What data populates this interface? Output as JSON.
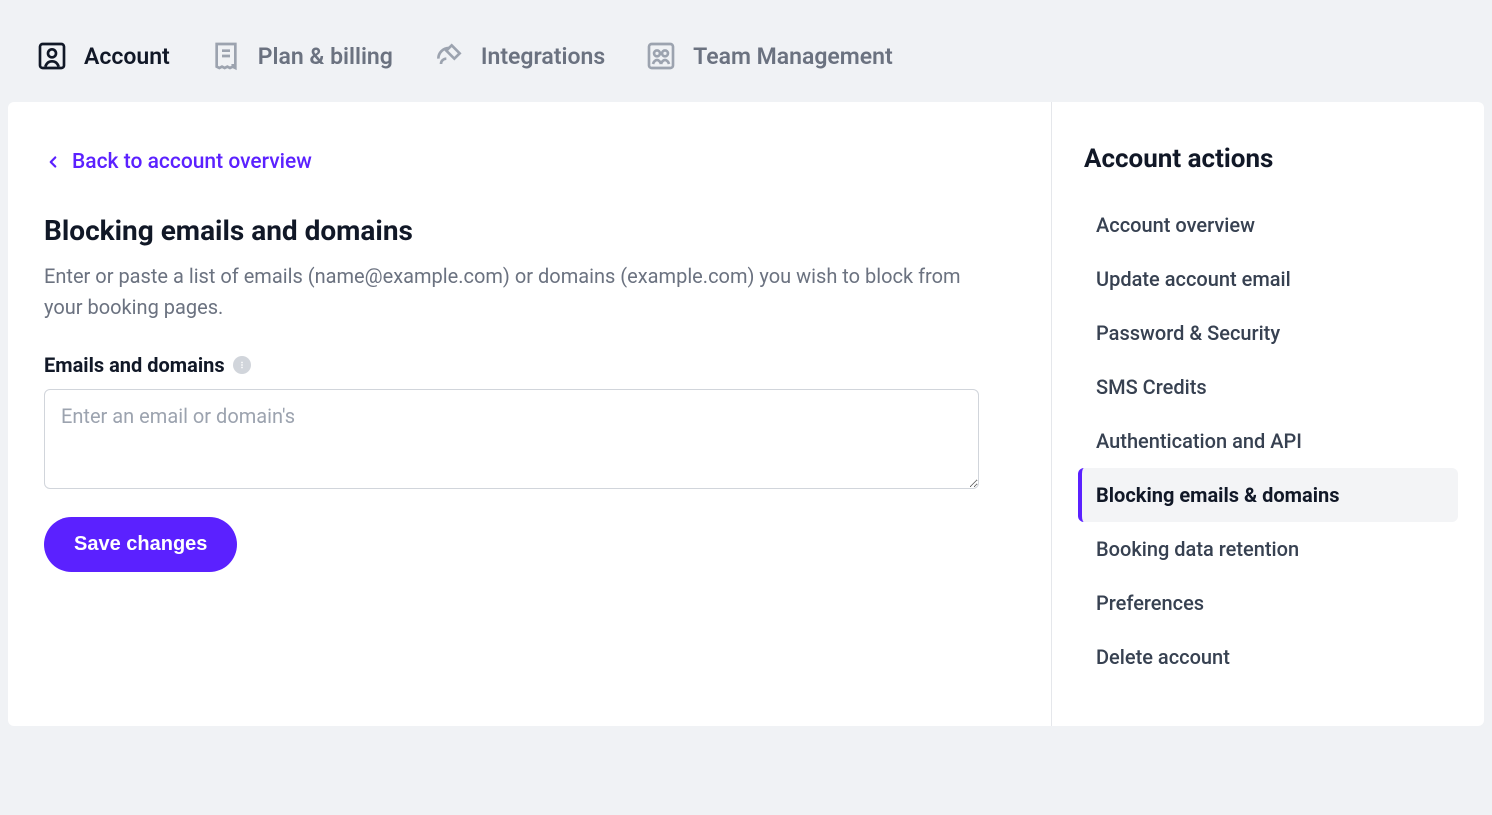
{
  "tabs": [
    {
      "label": "Account",
      "active": true
    },
    {
      "label": "Plan & billing",
      "active": false
    },
    {
      "label": "Integrations",
      "active": false
    },
    {
      "label": "Team Management",
      "active": false
    }
  ],
  "main": {
    "back_label": "Back to account overview",
    "title": "Blocking emails and domains",
    "subtitle": "Enter or paste a list of emails (name@example.com) or domains (example.com) you wish to block from your booking pages.",
    "field_label": "Emails and domains",
    "textarea_placeholder": "Enter an email or domain's",
    "textarea_value": "",
    "save_label": "Save changes"
  },
  "sidebar": {
    "title": "Account actions",
    "items": [
      {
        "label": "Account overview",
        "active": false
      },
      {
        "label": "Update account email",
        "active": false
      },
      {
        "label": "Password & Security",
        "active": false
      },
      {
        "label": "SMS Credits",
        "active": false
      },
      {
        "label": "Authentication and API",
        "active": false
      },
      {
        "label": "Blocking emails & domains",
        "active": true
      },
      {
        "label": "Booking data retention",
        "active": false
      },
      {
        "label": "Preferences",
        "active": false
      },
      {
        "label": "Delete account",
        "active": false
      }
    ]
  }
}
